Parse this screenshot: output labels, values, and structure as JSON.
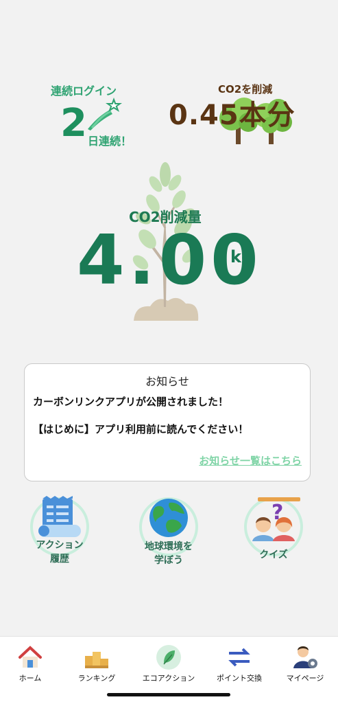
{
  "login": {
    "title": "連続ログイン",
    "count": "2",
    "suffix": "日連続！"
  },
  "co2_trees": {
    "title": "CO2を削減",
    "value": "0.45本分"
  },
  "reduction": {
    "title": "CO2削減量",
    "value": "4.00",
    "unit": "kg"
  },
  "news": {
    "heading": "お知らせ",
    "items": [
      "カーボンリンクアプリが公開されました！",
      "【はじめに】アプリ利用前に読んでください！"
    ],
    "link": "お知らせ一覧はこちら"
  },
  "menu": {
    "action_history": "アクション\n履歴",
    "learn_earth_line1": "地球環境を",
    "learn_earth_line2": "学ぼう",
    "action_line1": "アクション",
    "action_line2": "履歴",
    "quiz": "クイズ"
  },
  "tabs": [
    {
      "label": "ホーム",
      "icon": "house-icon"
    },
    {
      "label": "ランキング",
      "icon": "podium-icon"
    },
    {
      "label": "エコアクション",
      "icon": "leaf-icon"
    },
    {
      "label": "ポイント交換",
      "icon": "exchange-arrows-icon"
    },
    {
      "label": "マイページ",
      "icon": "user-gear-icon"
    }
  ],
  "colors": {
    "primary_green": "#1e8f5e",
    "brown": "#5a3413",
    "link_green": "#7fd4a6"
  }
}
